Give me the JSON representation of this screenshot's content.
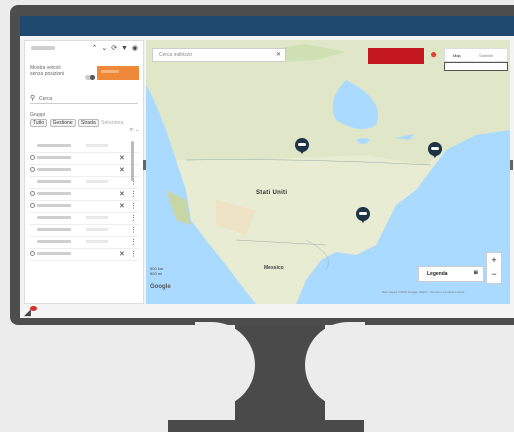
{
  "sidebar": {
    "tools": "⌃ ⌄ ⟳ ▼ ◉",
    "switch_label": "Mostra veicoli senza posizioni",
    "search_placeholder": "Cerca",
    "filter_label": "Gruppi",
    "chips": [
      "Tutto",
      "Gestione",
      "Strada"
    ],
    "chips_more": "Seleziona"
  },
  "map": {
    "search_placeholder": "Cerca indirizzo",
    "map_type": {
      "map": "Map",
      "satellite": "Satellite"
    },
    "country_label": "Stati Uniti",
    "mexico_label": "Messico",
    "legend_label": "Legenda",
    "legend_icon": "⊞",
    "zoom_in": "+",
    "zoom_out": "−",
    "scale_a": "500 km",
    "scale_b": "500 mi",
    "google": "Google",
    "attribution": "Dati mappa ©2018 Google, INEGI · Termini e condizioni d'uso"
  },
  "colors": {
    "topbar": "#1f4a6e",
    "orange_button": "#f0883a",
    "red_box": "#c3181f",
    "marker": "#1f3347",
    "water": "#aadaff"
  },
  "icons": [
    "search-icon",
    "location-pin-icon",
    "truck-marker-icon",
    "close-icon",
    "notification-icon"
  ]
}
